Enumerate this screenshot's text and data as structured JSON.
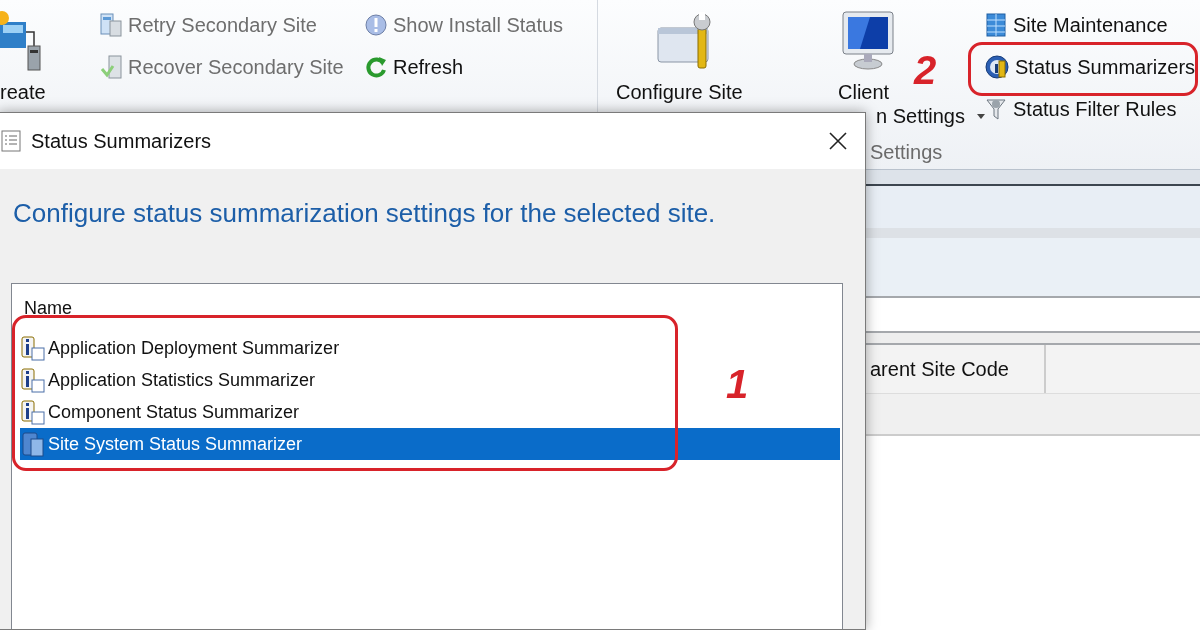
{
  "ribbon": {
    "sections": [
      {
        "kind": "large",
        "label": "reate"
      },
      {
        "kind": "stack",
        "items": [
          {
            "label": "Retry Secondary Site",
            "disabled": true
          },
          {
            "label": "Recover Secondary Site",
            "disabled": true
          }
        ]
      },
      {
        "kind": "stack",
        "items": [
          {
            "label": "Show Install Status",
            "disabled": true
          },
          {
            "label": "Refresh",
            "disabled": false
          }
        ]
      },
      {
        "kind": "large",
        "label": "Configure Site"
      },
      {
        "kind": "large",
        "label": "Client",
        "sublabel": "n Settings",
        "dropdown": true
      },
      {
        "kind": "stack",
        "items": [
          {
            "label": "Site Maintenance",
            "disabled": false
          },
          {
            "label": "Status Summarizers",
            "disabled": false
          },
          {
            "label": "Status Filter Rules",
            "disabled": false
          }
        ]
      }
    ],
    "group_label": "Settings"
  },
  "results": {
    "columns": [
      "arent Site Code"
    ]
  },
  "dialog": {
    "title": "Status Summarizers",
    "heading": "Configure status summarization settings for the selected site.",
    "list": {
      "column": "Name",
      "items": [
        {
          "label": "Application Deployment Summarizer",
          "selected": false
        },
        {
          "label": "Application Statistics Summarizer",
          "selected": false
        },
        {
          "label": "Component Status Summarizer",
          "selected": false
        },
        {
          "label": "Site System Status Summarizer",
          "selected": true
        }
      ]
    }
  },
  "annotations": [
    {
      "label": "1"
    },
    {
      "label": "2"
    }
  ]
}
